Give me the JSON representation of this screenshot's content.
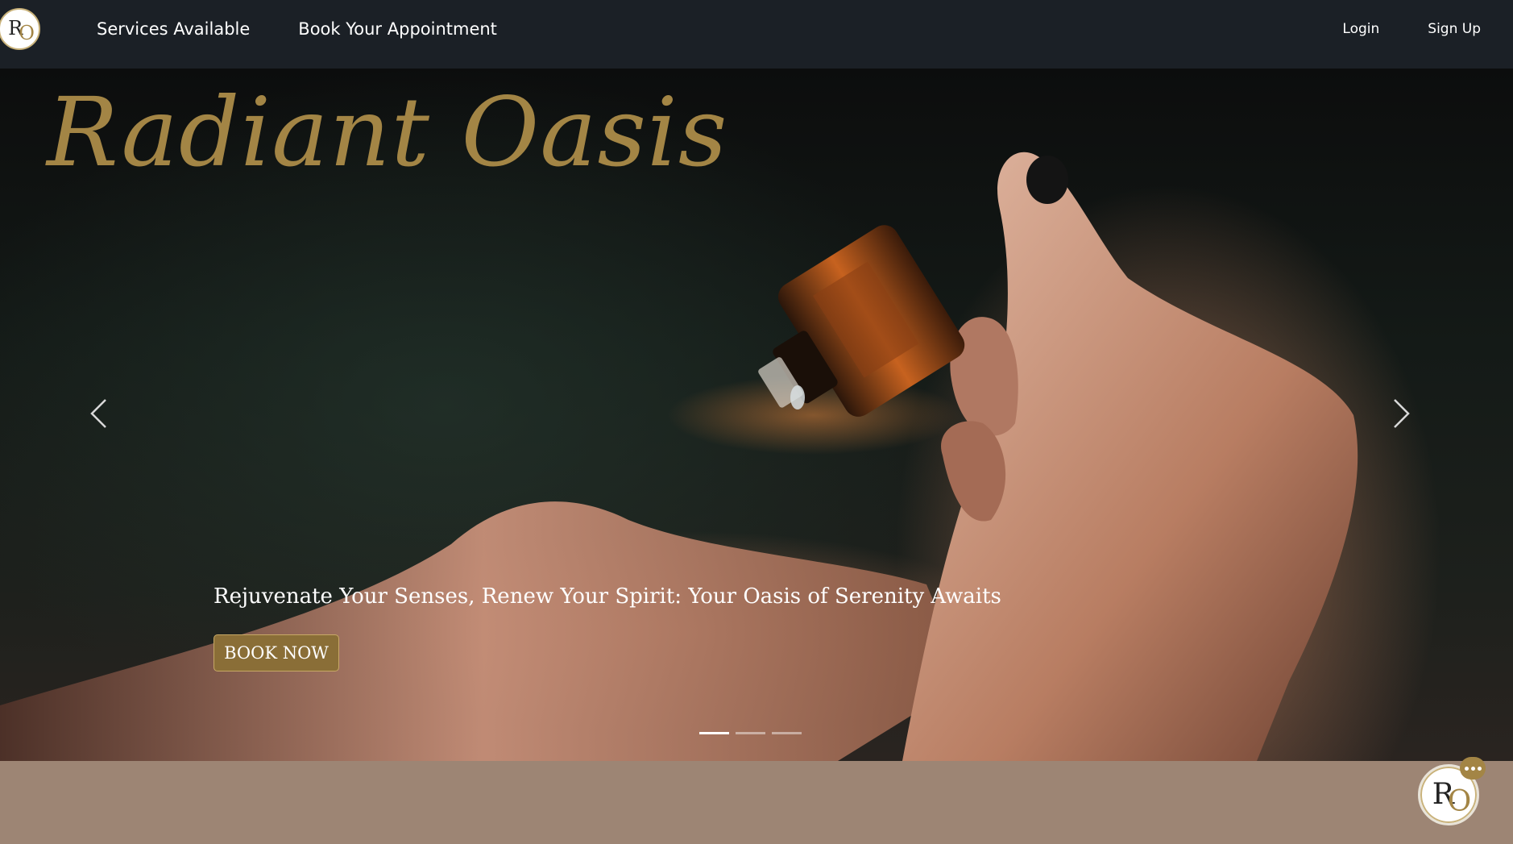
{
  "nav": {
    "logo_r": "R",
    "logo_o": "O",
    "links": [
      "Services Available",
      "Book Your Appointment"
    ],
    "login": "Login",
    "signup": "Sign Up"
  },
  "hero": {
    "brand": "Radiant Oasis",
    "tagline": "Rejuvenate Your Senses, Renew Your Spirit: Your Oasis of Serenity Awaits",
    "cta": "BOOK NOW",
    "slides": 3,
    "active_slide": 1
  },
  "chat": {
    "logo_r": "R",
    "logo_o": "O"
  },
  "colors": {
    "navbar": "#1b2026",
    "gold": "#a38545",
    "band": "#9d8574"
  }
}
